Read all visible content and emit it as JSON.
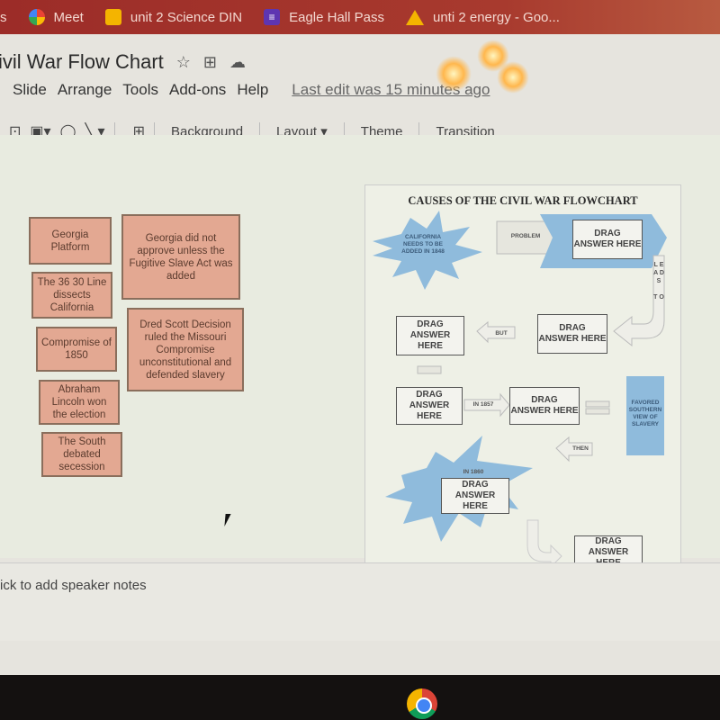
{
  "bookmarks": [
    {
      "label": "s",
      "icon": "partial-icon"
    },
    {
      "label": "Meet",
      "icon": "meet-icon"
    },
    {
      "label": "unit 2 Science DIN",
      "icon": "slides-icon"
    },
    {
      "label": "Eagle Hall Pass",
      "icon": "forms-icon"
    },
    {
      "label": "unti 2 energy - Goo...",
      "icon": "drive-icon"
    }
  ],
  "doc": {
    "title": "ivil War Flow Chart",
    "star": "☆",
    "move": "⊞",
    "cloud": "☁"
  },
  "menu": {
    "items": [
      "Slide",
      "Arrange",
      "Tools",
      "Add-ons",
      "Help"
    ],
    "last_edit": "Last edit was 15 minutes ago"
  },
  "toolbar": {
    "background": "Background",
    "layout": "Layout ▾",
    "theme": "Theme",
    "transition": "Transition"
  },
  "cards": [
    "Georgia Platform",
    "Georgia did not approve unless the Fugitive Slave Act was added",
    "The 36 30 Line dissects California",
    "Dred Scott Decision ruled the Missouri Compromise unconstitutional and defended slavery",
    "Compromise of 1850",
    "Abraham Lincoln won the election",
    "The South debated secession"
  ],
  "slide": {
    "title": "CAUSES OF THE CIVIL WAR FLOWCHART",
    "california": "CALIFORNIA NEEDS TO BE ADDED IN 1848",
    "problem": "PROBLEM",
    "drag": "DRAG ANSWER HERE",
    "leads_to": "L E A D S   T O",
    "but": "BUT",
    "in_1857": "IN 1857",
    "favored": "FAVORED SOUTHERN VIEW OF SLAVERY",
    "then": "THEN",
    "in_1860": "IN 1860"
  },
  "notes": {
    "placeholder": "ick to add speaker notes"
  },
  "colors": {
    "bookmark_bar": "#a3332c",
    "card_fill": "#e3a892",
    "blue_shape": "#8fbbdc"
  }
}
